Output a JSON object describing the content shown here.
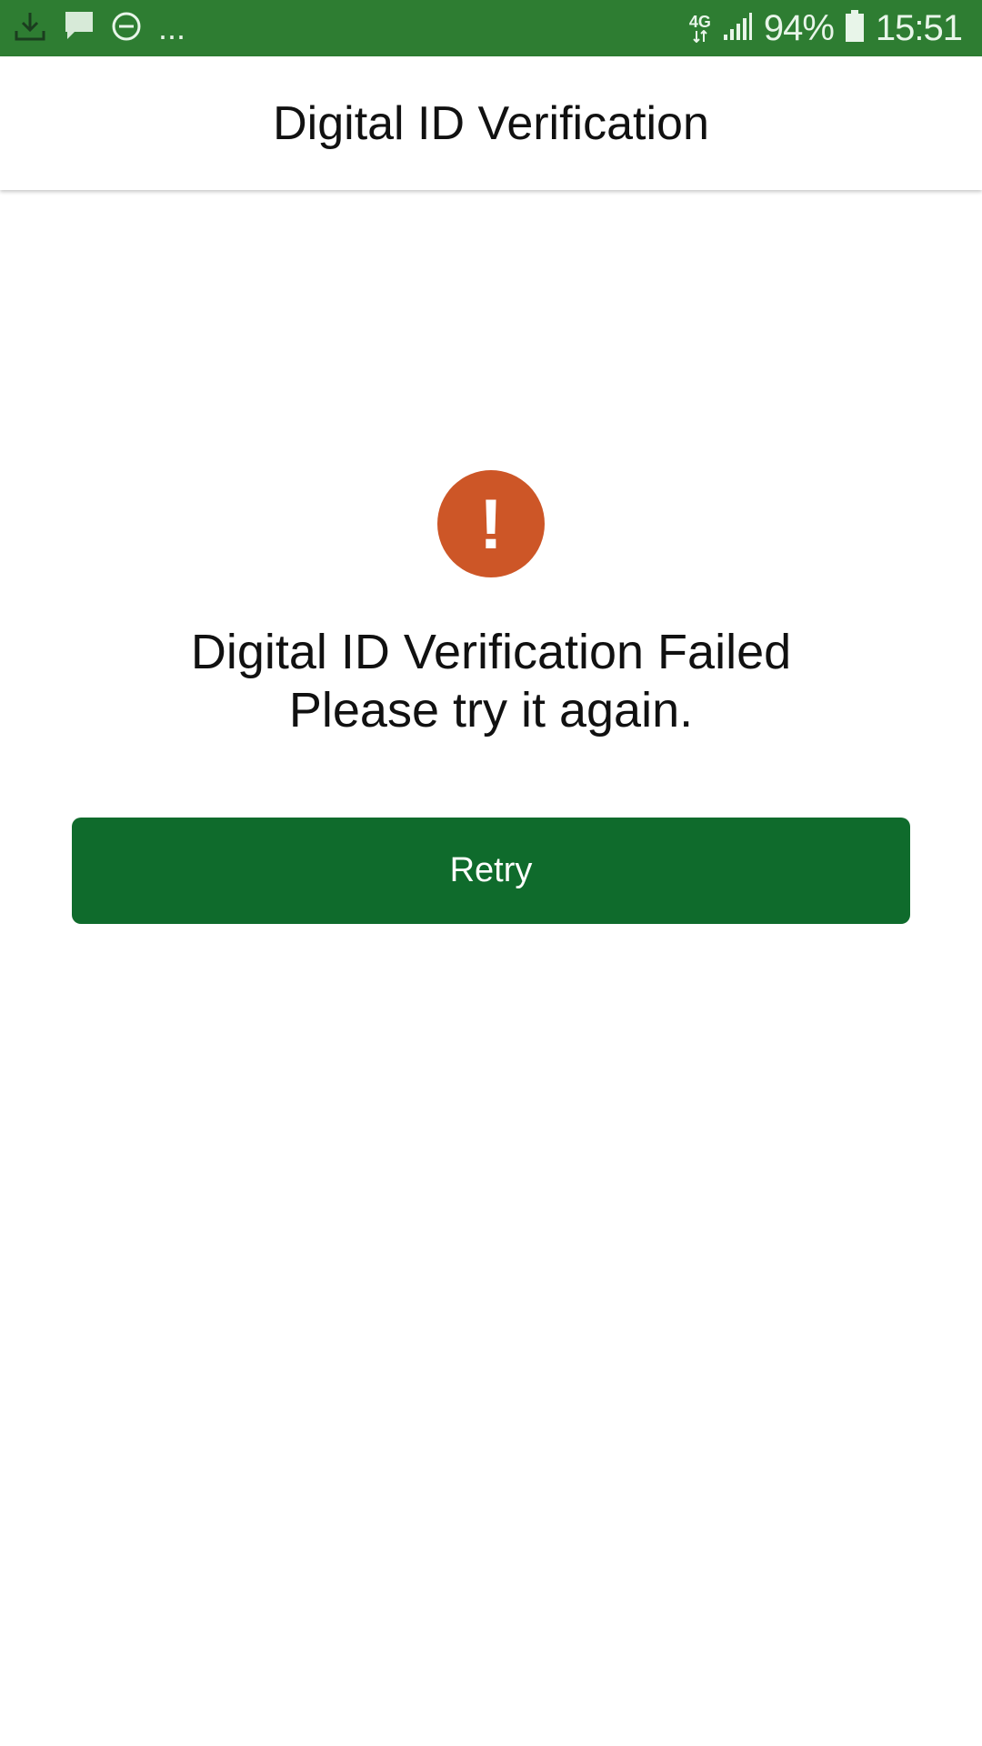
{
  "status_bar": {
    "left_icons": [
      "download-icon",
      "message-icon",
      "do-not-disturb-icon"
    ],
    "more_indicator": "...",
    "network_type": "4G",
    "battery_percent": "94%",
    "time": "15:51",
    "colors": {
      "background": "#2e7d32"
    }
  },
  "app_bar": {
    "title": "Digital ID Verification"
  },
  "error": {
    "icon": "error-alert-icon",
    "icon_glyph": "!",
    "icon_color": "#cd5627",
    "message_line1": "Digital ID Verification Failed",
    "message_line2": "Please try it again."
  },
  "actions": {
    "retry_label": "Retry",
    "button_color": "#0f6b2c"
  }
}
